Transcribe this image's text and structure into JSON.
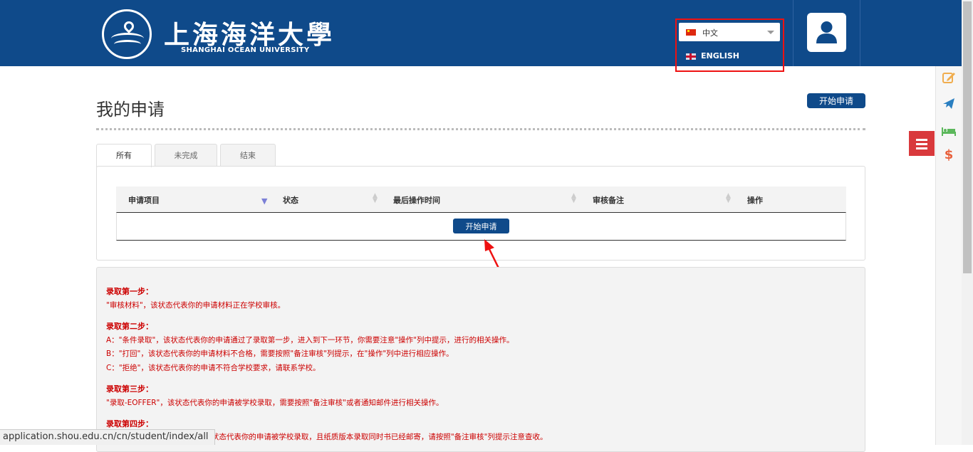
{
  "header": {
    "university_cn": "上海海洋大學",
    "university_en": "SHANGHAI OCEAN UNIVERSITY",
    "language": {
      "selected": "中文",
      "option_en": "ENGLISH"
    },
    "brand_color": "#0f4a8a"
  },
  "side_rail": {
    "icons": [
      "edit-icon",
      "plane-icon",
      "bed-icon",
      "dollar-icon"
    ],
    "menu_icon": "menu-icon"
  },
  "page": {
    "title": "我的申请",
    "start_button": "开始申请"
  },
  "tabs": [
    {
      "label": "所有",
      "active": true
    },
    {
      "label": "未完成",
      "active": false
    },
    {
      "label": "结束",
      "active": false
    }
  ],
  "table": {
    "columns": [
      "申请项目",
      "状态",
      "最后操作时间",
      "审核备注",
      "操作"
    ],
    "empty_row_button": "开始申请"
  },
  "steps": {
    "s1_title": "录取第一步：",
    "s1_l1": "\"审核材料\"，该状态代表你的申请材料正在学校审核。",
    "s2_title": "录取第二步：",
    "s2_l1": "A：\"条件录取\"，该状态代表你的申请通过了录取第一步，进入到下一环节，你需要注意\"操作\"列中提示，进行的相关操作。",
    "s2_l2": "B：\"打回\"，该状态代表你的申请材料不合格，需要按照\"备注审核\"列提示，在\"操作\"列中进行相应操作。",
    "s2_l3": "C：\"拒绝\"，该状态代表你的申请不符合学校要求，请联系学校。",
    "s3_title": "录取第三步：",
    "s3_l1": "\"录取-EOFFER\"，该状态代表你的申请被学校录取，需要按照\"备注审核\"或者通知邮件进行相关操作。",
    "s4_title": "录取第四步：",
    "s4_l1": "\"，该状态代表你的申请被学校录取，且纸质版本录取同时书已经邮寄，请按照\"备注审核\"列提示注意查收。"
  },
  "status_bar": {
    "url": "application.shou.edu.cn/cn/student/index/all"
  }
}
